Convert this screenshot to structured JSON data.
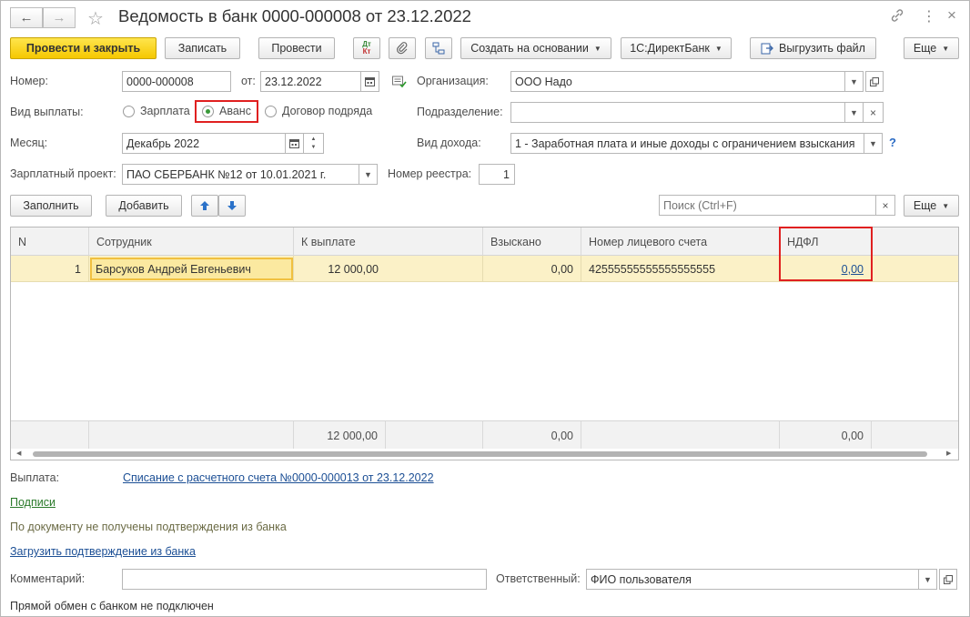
{
  "window": {
    "title": "Ведомость в банк 0000-000008 от 23.12.2022"
  },
  "toolbar": {
    "post_close": "Провести и закрыть",
    "save": "Записать",
    "post": "Провести",
    "dtkt_top": "Дт",
    "dtkt_bottom": "Кт",
    "create_based": "Создать на основании",
    "direct_bank": "1С:ДиректБанк",
    "export_file": "Выгрузить файл",
    "more": "Еще"
  },
  "form": {
    "number_label": "Номер:",
    "number_value": "0000-000008",
    "date_label": "от:",
    "date_value": "23.12.2022",
    "org_label": "Организация:",
    "org_value": "ООО Надо",
    "payment_type_label": "Вид выплаты:",
    "payment_options": [
      "Зарплата",
      "Аванс",
      "Договор подряда"
    ],
    "payment_selected": "Аванс",
    "dept_label": "Подразделение:",
    "dept_value": "",
    "month_label": "Месяц:",
    "month_value": "Декабрь 2022",
    "income_type_label": "Вид дохода:",
    "income_type_value": "1 - Заработная плата и иные доходы с ограничением взыскания",
    "help": "?",
    "salary_project_label": "Зарплатный проект:",
    "salary_project_value": "ПАО СБЕРБАНК №12 от 10.01.2021 г.",
    "registry_label": "Номер реестра:",
    "registry_value": "1"
  },
  "table_toolbar": {
    "fill": "Заполнить",
    "add": "Добавить",
    "search_placeholder": "Поиск (Ctrl+F)",
    "more": "Еще"
  },
  "table": {
    "columns": [
      "N",
      "Сотрудник",
      "К выплате",
      "Взыскано",
      "Номер лицевого счета",
      "НДФЛ"
    ],
    "rows": [
      {
        "n": "1",
        "employee": "Барсуков Андрей Евгеньевич",
        "to_pay": "12 000,00",
        "collected": "0,00",
        "account": "42555555555555555555",
        "ndfl": "0,00"
      }
    ],
    "totals": {
      "to_pay": "12 000,00",
      "collected": "0,00",
      "ndfl": "0,00"
    }
  },
  "footer": {
    "payment_label": "Выплата:",
    "payment_link": "Списание с расчетного счета №0000-000013 от 23.12.2022",
    "signatures_link": "Подписи",
    "bank_status": "По документу не получены подтверждения из банка",
    "load_confirmation_link": "Загрузить подтверждение из банка",
    "comment_label": "Комментарий:",
    "comment_value": "",
    "responsible_label": "Ответственный:",
    "responsible_value": "ФИО пользователя",
    "exchange_status": "Прямой обмен с банком не подключен"
  },
  "colors": {
    "primary_button": "#f5c800",
    "selected_row": "#fbf1c7",
    "highlight_border": "#e02020",
    "link": "#1c4f95"
  }
}
